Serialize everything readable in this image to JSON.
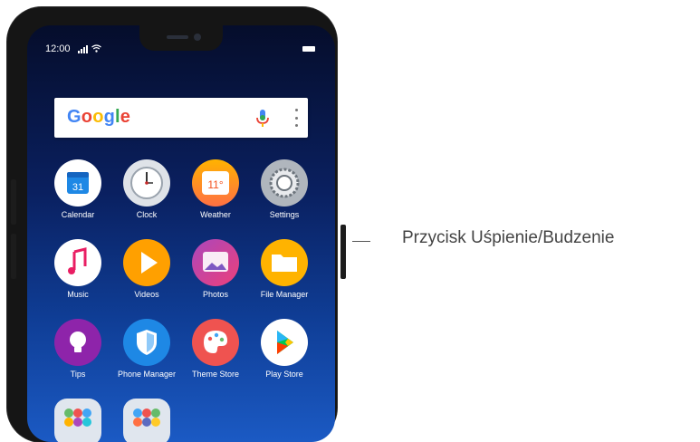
{
  "status_bar": {
    "time": "12:00"
  },
  "search_bar": {
    "logo_letters": [
      "G",
      "o",
      "o",
      "g",
      "l",
      "e"
    ]
  },
  "apps": [
    {
      "label": "Calendar",
      "icon": "calendar-icon",
      "detail": "31"
    },
    {
      "label": "Clock",
      "icon": "clock-icon"
    },
    {
      "label": "Weather",
      "icon": "weather-icon",
      "detail": "11°"
    },
    {
      "label": "Settings",
      "icon": "settings-icon"
    },
    {
      "label": "Music",
      "icon": "music-icon"
    },
    {
      "label": "Videos",
      "icon": "videos-icon"
    },
    {
      "label": "Photos",
      "icon": "photos-icon"
    },
    {
      "label": "File Manager",
      "icon": "file-manager-icon"
    },
    {
      "label": "Tips",
      "icon": "tips-icon"
    },
    {
      "label": "Phone Manager",
      "icon": "phone-manager-icon"
    },
    {
      "label": "Theme Store",
      "icon": "theme-store-icon"
    },
    {
      "label": "Play Store",
      "icon": "play-store-icon"
    }
  ],
  "callout": {
    "label": "Przycisk Uśpienie/Budzenie"
  },
  "colors": {
    "accent_wallpaper": "#0f3d95",
    "callout_text": "#444444"
  }
}
